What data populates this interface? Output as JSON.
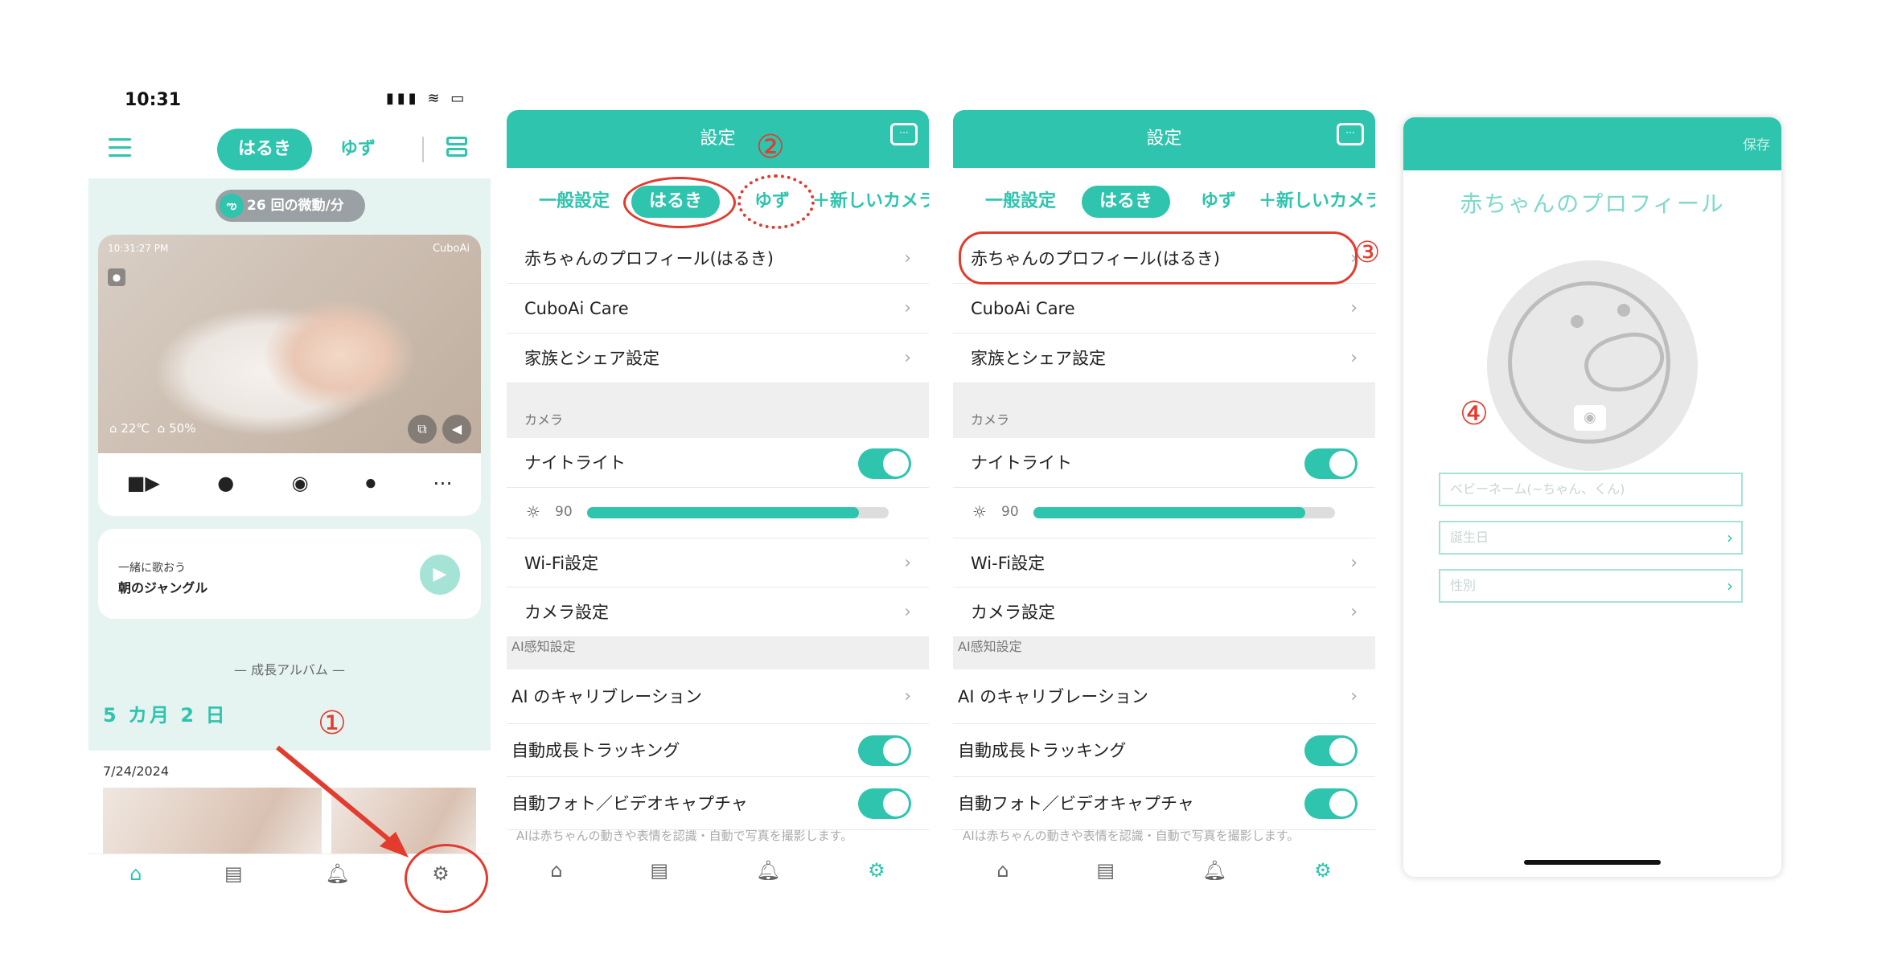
{
  "home": {
    "status_time": "10:31",
    "status_icons": "▮▮▮ ≋ ▭",
    "menu_icon": "menu-icon",
    "child_tabs": [
      "はるき",
      "ゆず"
    ],
    "motion": "26 回の微動/分",
    "video": {
      "timestamp": "10:31:27 PM",
      "brand": "CuboAi",
      "temperature": "22℃",
      "humidity": "50%"
    },
    "controls": [
      "video-camera-icon",
      "lightbulb-icon",
      "camera-icon",
      "microphone-icon",
      "more-icon"
    ],
    "song": {
      "subtitle": "一緒に歌おう",
      "title": "朝のジャングル"
    },
    "album_heading": "成長アルバム",
    "age": "5 カ月 2 日",
    "date": "7/24/2024",
    "tabbar": [
      "home-icon",
      "chart-icon",
      "bell-icon",
      "gear-icon"
    ]
  },
  "settings": {
    "title": "設定",
    "tabs": [
      "一般設定",
      "はるき",
      "ゆず",
      "＋新しいカメラ"
    ],
    "profile_row": "赤ちゃんのプロフィール(はるき)",
    "care_row": "CuboAi Care",
    "family_row": "家族とシェア設定",
    "camera_section": "カメラ",
    "nightlight_row": "ナイトライト",
    "nightlight_on": true,
    "brightness": 90,
    "brightness_label": "90",
    "wifi_row": "Wi-Fi設定",
    "camera_settings_row": "カメラ設定",
    "ai_section": "AI感知設定",
    "calibration_row": "AI のキャリブレーション",
    "tracking_row": "自動成長トラッキング",
    "tracking_on": true,
    "capture_row": "自動フォト／ビデオキャプチャ",
    "capture_on": true,
    "footnote": "AIは赤ちゃんの動きや表情を認識・自動で写真を撮影します。"
  },
  "profile": {
    "save": "保存",
    "title": "赤ちゃんのプロフィール",
    "name_placeholder": "ベビーネーム(~ちゃん、くん)",
    "birthday_label": "誕生日",
    "gender_label": "性別"
  },
  "annotations": {
    "step1": "①",
    "step2": "②",
    "step3": "③",
    "step4": "④"
  },
  "colors": {
    "accent": "#2ec4ae",
    "annotation": "#e33b2e"
  }
}
